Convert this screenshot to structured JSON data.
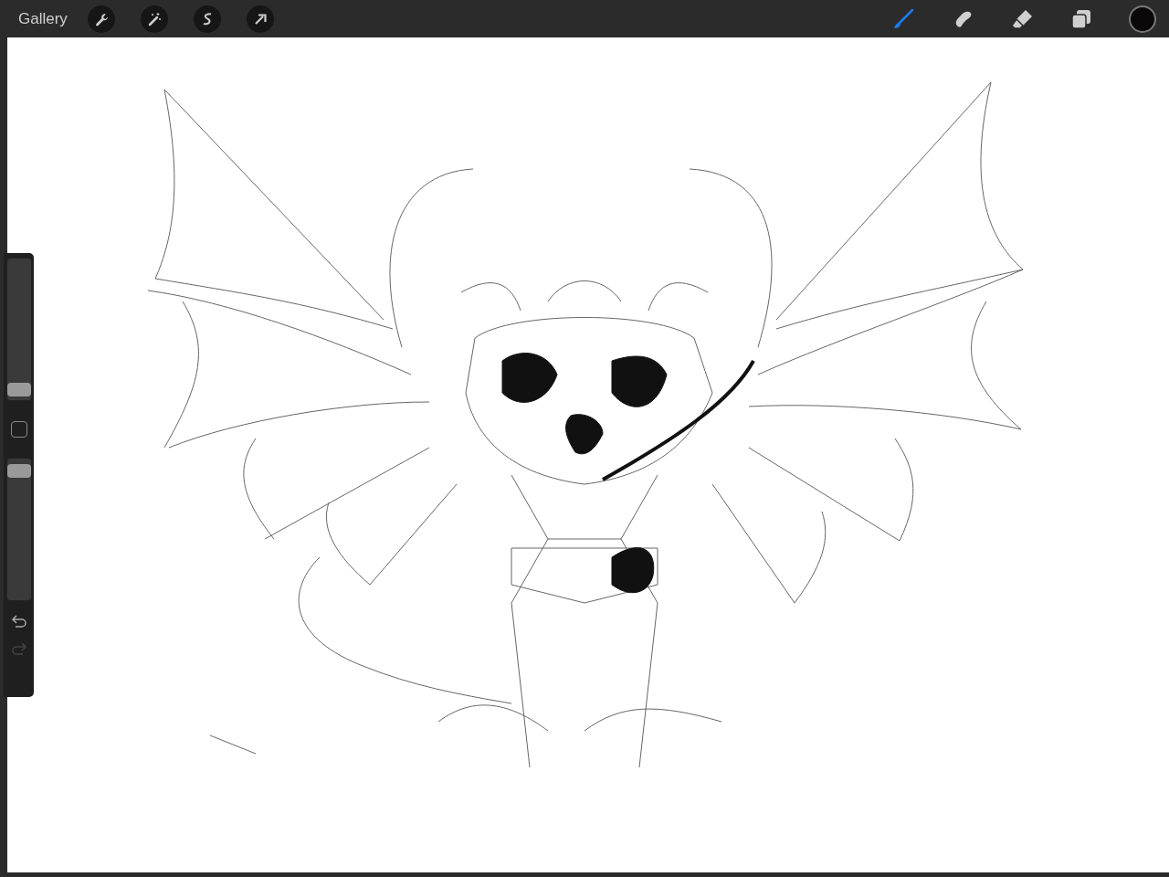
{
  "top_bar": {
    "gallery": "Gallery",
    "actions": [
      {
        "kind": "wrench"
      },
      {
        "kind": "wand"
      },
      {
        "kind": "selection"
      },
      {
        "kind": "arrow"
      }
    ],
    "tools": [
      {
        "kind": "brush",
        "selected": true
      },
      {
        "kind": "smudge",
        "selected": false
      },
      {
        "kind": "eraser",
        "selected": false
      },
      {
        "kind": "layers",
        "selected": false
      }
    ],
    "color": "#0a0808"
  },
  "sidebar": {
    "size_slider": {
      "level": 0.03
    },
    "opacity_slider": {
      "level": 0.96
    },
    "undo": {
      "disabled": false
    },
    "redo": {
      "disabled": true
    }
  }
}
